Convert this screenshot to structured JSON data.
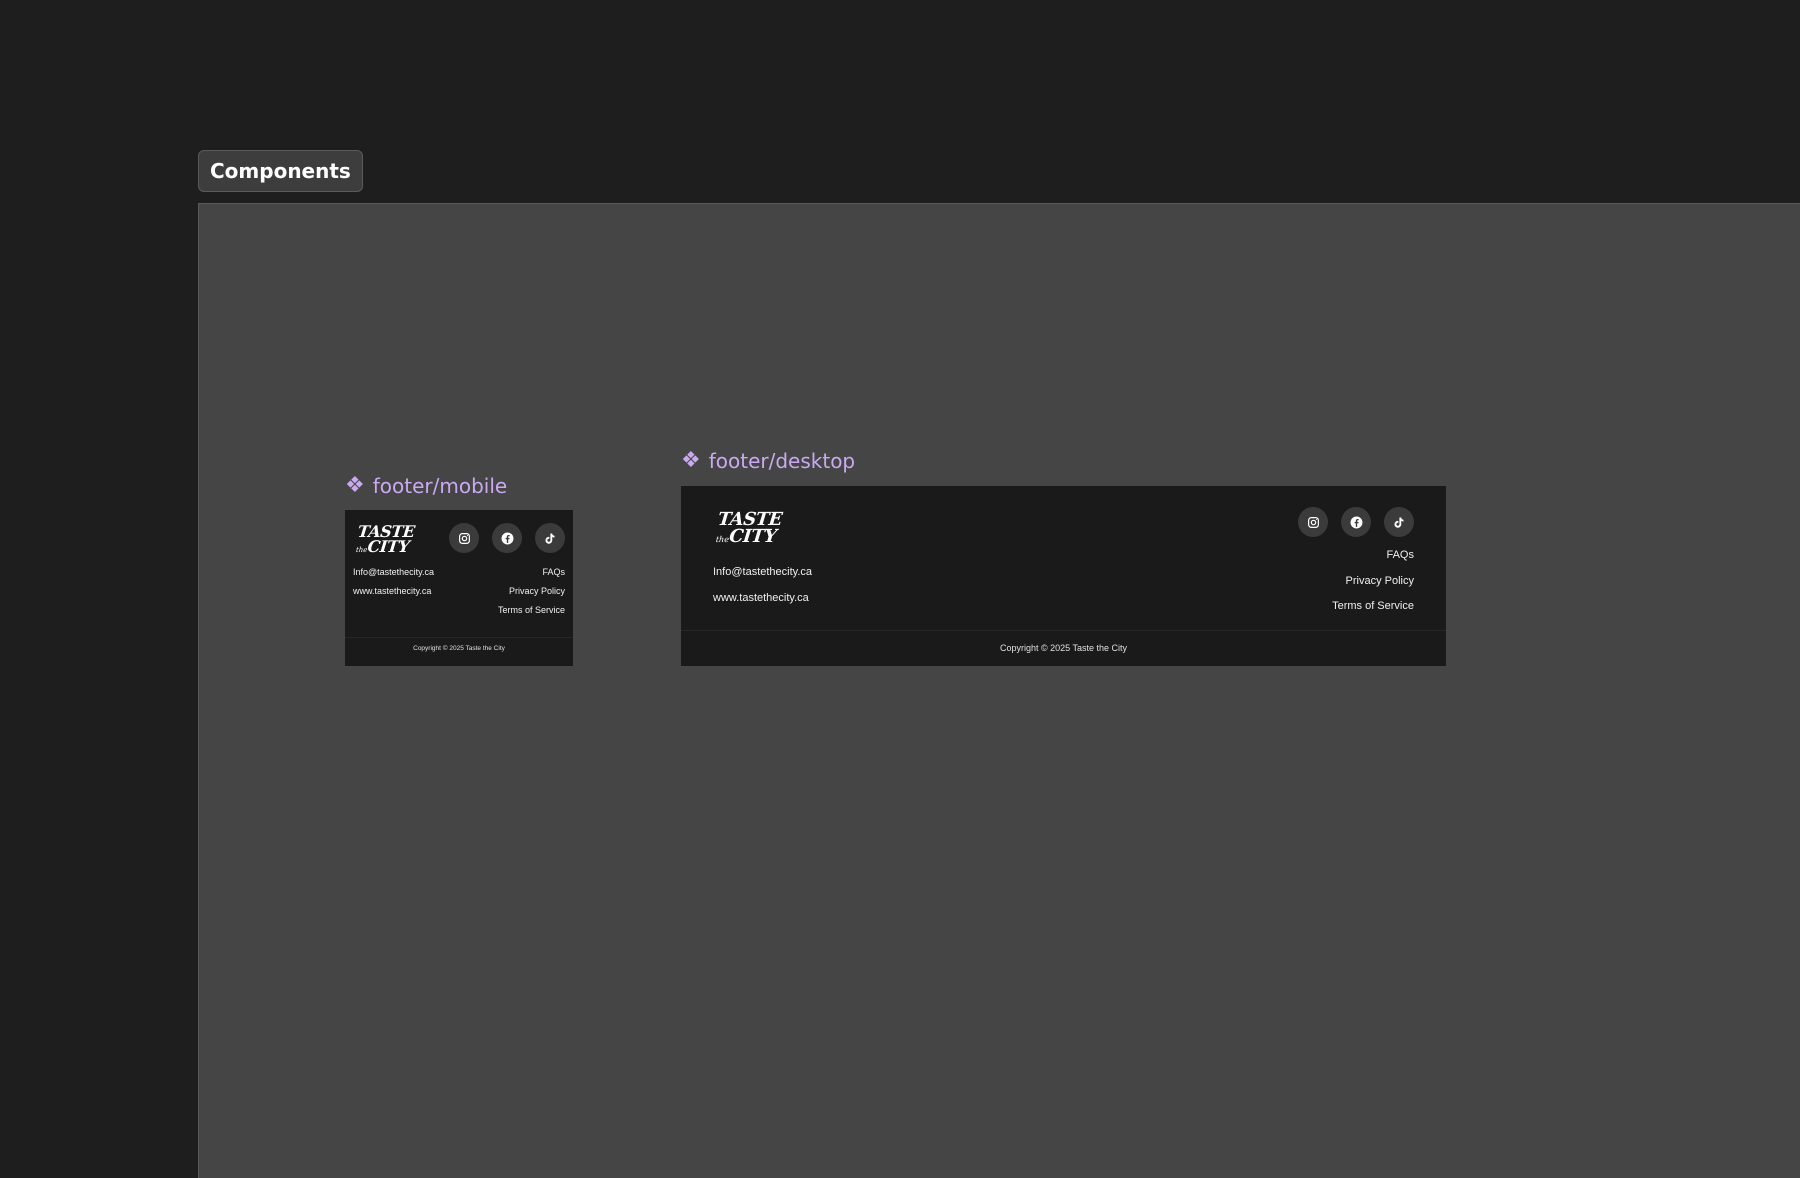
{
  "canvas": {
    "section_label": "Components"
  },
  "components": {
    "mobile": {
      "title": "footer/mobile",
      "icon": "component-diamond-icon"
    },
    "desktop": {
      "title": "footer/desktop",
      "icon": "component-diamond-icon"
    }
  },
  "footer": {
    "logo": {
      "line1": "TASTE",
      "line2": "the",
      "line3": "CITY"
    },
    "socials": [
      {
        "name": "instagram-icon"
      },
      {
        "name": "facebook-icon"
      },
      {
        "name": "tiktok-icon"
      }
    ],
    "email": "Info@tastethecity.ca",
    "website": "www.tastethecity.ca",
    "links": {
      "faqs": "FAQs",
      "privacy": "Privacy Policy",
      "terms": "Terms of Service"
    },
    "copyright": "Copyright © 2025 Taste the City"
  },
  "colors": {
    "canvas_bg": "#1e1e1e",
    "section_bg": "#454545",
    "footer_bg": "#1a1a1a",
    "component_label": "#c9a9f0",
    "social_bg": "#3b3b3b"
  }
}
